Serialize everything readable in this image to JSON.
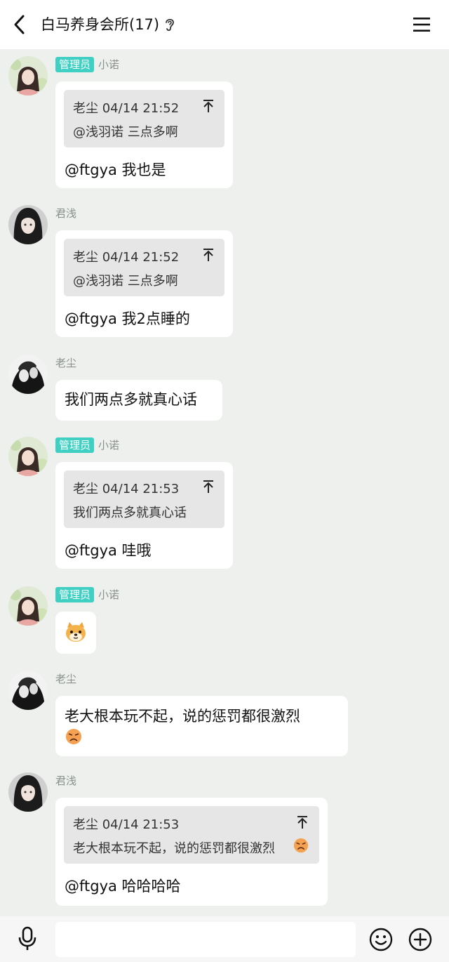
{
  "header": {
    "title": "白马养身会所(17)",
    "back_icon": "chevron-left-icon",
    "ear_icon": "ear-icon",
    "menu_icon": "hamburger-menu-icon"
  },
  "messages": [
    {
      "badge": "管理员",
      "sender": "小诺",
      "quote_head": "老尘 04/14 21:52",
      "quote_body": "@浅羽诺 三点多啊",
      "text": "@ftgya 我也是"
    },
    {
      "sender": "君浅",
      "quote_head": "老尘 04/14 21:52",
      "quote_body": "@浅羽诺 三点多啊",
      "text": "@ftgya 我2点睡的"
    },
    {
      "sender": "老尘",
      "text": "我们两点多就真心话"
    },
    {
      "badge": "管理员",
      "sender": "小诺",
      "quote_head": "老尘 04/14 21:53",
      "quote_body": "我们两点多就真心话",
      "text": "@ftgya 哇哦"
    },
    {
      "badge": "管理员",
      "sender": "小诺",
      "sticker": "dog-face-sticker"
    },
    {
      "sender": "老尘",
      "text": "老大根本玩不起，说的惩罚都很激烈",
      "emoji": "angry-face-emoji"
    },
    {
      "sender": "君浅",
      "quote_head": "老尘 04/14 21:53",
      "quote_body": "老大根本玩不起，说的惩罚都很激烈",
      "quote_emoji": "angry-face-emoji",
      "text": "@ftgya 哈哈哈哈"
    }
  ],
  "bottom": {
    "mic_icon": "microphone-icon",
    "input_value": "",
    "emoji_icon": "smiley-icon",
    "plus_icon": "plus-circle-icon"
  },
  "colors": {
    "background": "#edf0ec",
    "admin_badge": "#3fcfc3",
    "bubble": "#ffffff",
    "quote": "#e6e6e6"
  }
}
